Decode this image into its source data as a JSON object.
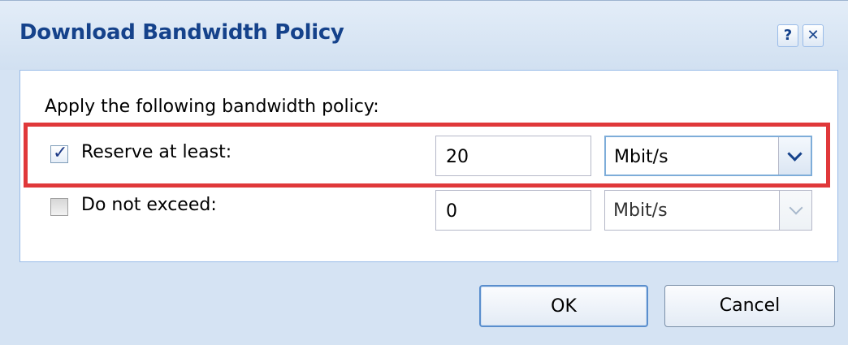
{
  "dialog": {
    "title": "Download Bandwidth Policy",
    "help_label": "?",
    "close_label": "✕"
  },
  "panel": {
    "intro": "Apply the following bandwidth policy:",
    "rows": [
      {
        "label": "Reserve at least:",
        "checked": true,
        "value": "20",
        "unit": "Mbit/s",
        "highlighted": true
      },
      {
        "label": "Do not exceed:",
        "checked": false,
        "value": "0",
        "unit": "Mbit/s",
        "disabled": true
      }
    ]
  },
  "buttons": {
    "ok": "OK",
    "cancel": "Cancel"
  },
  "colors": {
    "title": "#15428b",
    "highlight": "#e0383a",
    "dialog_bg": "#d5e3f3"
  },
  "icons": {
    "checkmark": "check-icon",
    "dropdown": "chevron-down-icon"
  }
}
